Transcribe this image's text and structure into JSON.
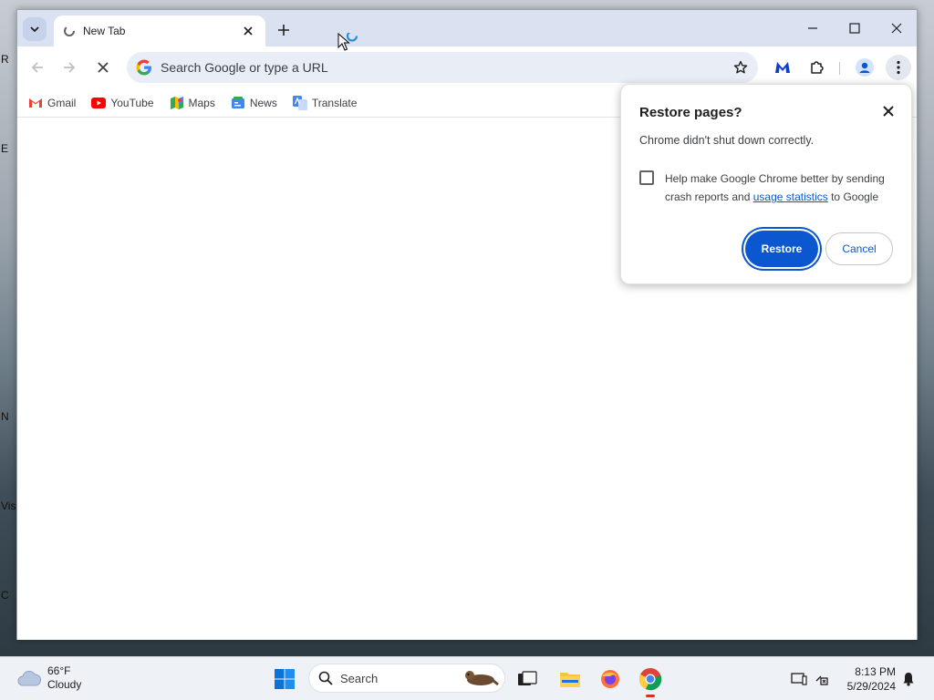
{
  "desktop": {
    "side_labels": [
      "R",
      "E",
      "N",
      "Vis",
      "C"
    ]
  },
  "browser": {
    "tab": {
      "title": "New Tab"
    },
    "omnibox": {
      "placeholder": "Search Google or type a URL"
    },
    "bookmarks": [
      {
        "label": "Gmail",
        "icon": "gmail-icon"
      },
      {
        "label": "YouTube",
        "icon": "youtube-icon"
      },
      {
        "label": "Maps",
        "icon": "maps-icon"
      },
      {
        "label": "News",
        "icon": "news-icon"
      },
      {
        "label": "Translate",
        "icon": "translate-icon"
      }
    ]
  },
  "dialog": {
    "title": "Restore pages?",
    "message": "Chrome didn't shut down correctly.",
    "checkbox_text_before": "Help make Google Chrome better by sending crash reports and ",
    "checkbox_link": "usage statistics",
    "checkbox_text_after": " to Google",
    "checkbox_checked": false,
    "restore_label": "Restore",
    "cancel_label": "Cancel"
  },
  "taskbar": {
    "weather_temp": "66°F",
    "weather_desc": "Cloudy",
    "search_label": "Search",
    "time": "8:13 PM",
    "date": "5/29/2024"
  },
  "colors": {
    "accent": "#0b57d0",
    "titlebar": "#dae2f2",
    "omnibox": "#e9eef6"
  }
}
